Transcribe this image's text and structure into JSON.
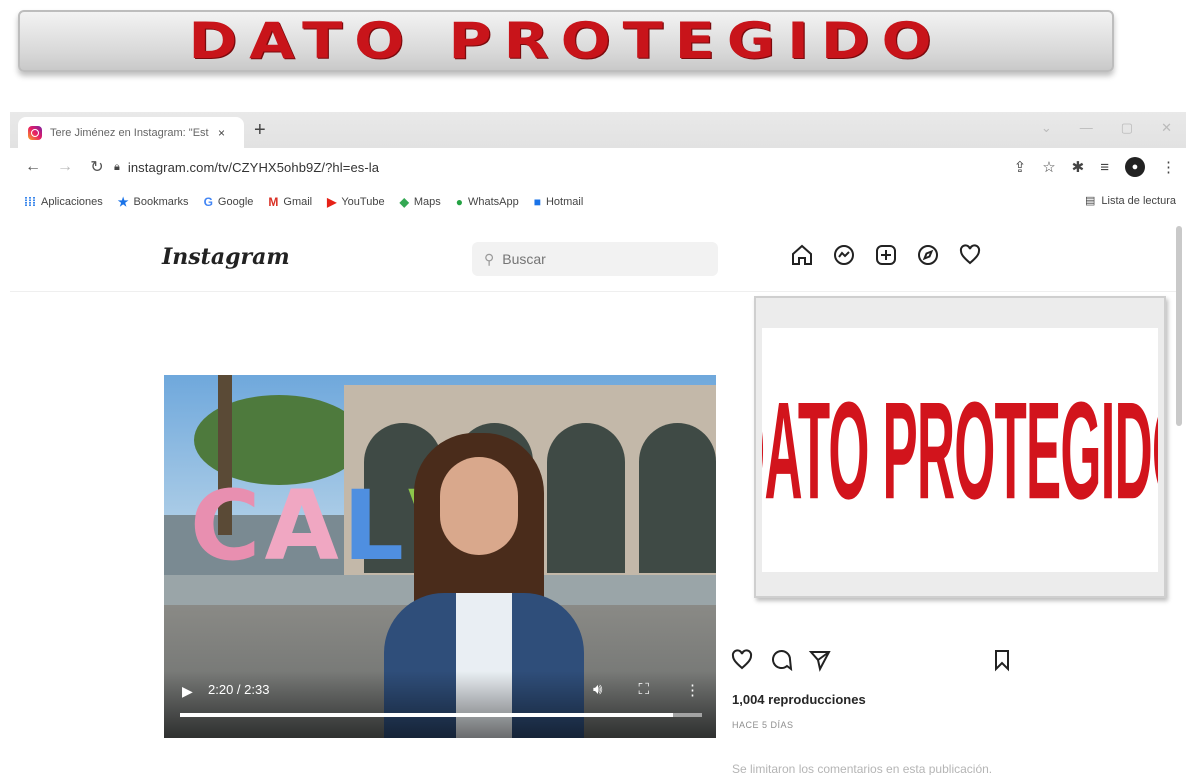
{
  "banner": {
    "text": "DATO PROTEGIDO"
  },
  "side_banner": {
    "text": "DATO PROTEGIDO"
  },
  "browser": {
    "tab_title": "Tere Jiménez en Instagram: \"Est",
    "tab_close": "×",
    "new_tab": "+",
    "url": "instagram.com/tv/CZYHX5ohb9Z/?hl=es-la",
    "bookmarks": [
      {
        "icon": "apps-icon",
        "label": "Aplicaciones"
      },
      {
        "icon": "star-icon",
        "label": "Bookmarks"
      },
      {
        "icon": "google-icon",
        "label": "Google"
      },
      {
        "icon": "gmail-icon",
        "label": "Gmail"
      },
      {
        "icon": "youtube-icon",
        "label": "YouTube"
      },
      {
        "icon": "maps-icon",
        "label": "Maps"
      },
      {
        "icon": "whatsapp-icon",
        "label": "WhatsApp"
      },
      {
        "icon": "hotmail-icon",
        "label": "Hotmail"
      }
    ],
    "reading_list": "Lista de lectura"
  },
  "instagram": {
    "logo": "Instagram",
    "search_placeholder": "Buscar",
    "nav_icons": [
      "home-icon",
      "messenger-icon",
      "new-post-icon",
      "explore-icon",
      "activity-heart-icon"
    ],
    "video": {
      "sign_letters": "CALVI",
      "time": "2:20 / 2:33",
      "progress": 0.944
    },
    "views": "1,004 reproducciones",
    "date": "HACE 5 DÍAS",
    "comments_notice": "Se limitaron los comentarios en esta publicación."
  },
  "colors": {
    "redaction_red": "#d2141c",
    "instagram_text": "#262626",
    "muted": "#8e8e8e"
  }
}
